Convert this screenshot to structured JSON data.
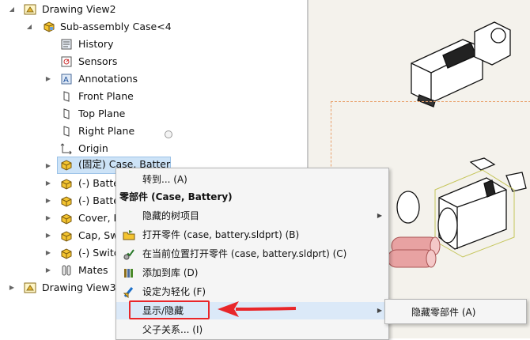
{
  "tree": {
    "items": [
      {
        "label": "Drawing View2",
        "icon": "drawing-view-icon"
      },
      {
        "label": "Sub-assembly Case<4",
        "icon": "assembly-icon"
      },
      {
        "label": "History",
        "icon": "history-icon"
      },
      {
        "label": "Sensors",
        "icon": "sensors-icon"
      },
      {
        "label": "Annotations",
        "icon": "annotations-icon"
      },
      {
        "label": "Front Plane",
        "icon": "plane-icon"
      },
      {
        "label": "Top Plane",
        "icon": "plane-icon"
      },
      {
        "label": "Right Plane",
        "icon": "plane-icon"
      },
      {
        "label": "Origin",
        "icon": "origin-icon"
      },
      {
        "label": "(固定) Case, Batter",
        "icon": "part-icon"
      },
      {
        "label": "(-) Batte",
        "icon": "part-icon"
      },
      {
        "label": "(-) Batte",
        "icon": "part-icon"
      },
      {
        "label": "Cover, B",
        "icon": "part-icon"
      },
      {
        "label": "Cap, Sw",
        "icon": "part-icon"
      },
      {
        "label": "(-) Switc",
        "icon": "part-icon"
      },
      {
        "label": "Mates",
        "icon": "mates-icon"
      },
      {
        "label": "Drawing View3",
        "icon": "drawing-view-icon"
      }
    ]
  },
  "context_menu": {
    "items": [
      {
        "label": "转到... (A)"
      },
      {
        "label": "零部件 (Case, Battery)"
      },
      {
        "label": "隐藏的树项目"
      },
      {
        "label": "打开零件 (case, battery.sldprt) (B)",
        "icon": "open-part-icon"
      },
      {
        "label": "在当前位置打开零件 (case, battery.sldprt) (C)",
        "icon": "open-in-place-icon"
      },
      {
        "label": "添加到库 (D)",
        "icon": "add-to-library-icon"
      },
      {
        "label": "设定为轻化 (F)",
        "icon": "lightweight-icon"
      },
      {
        "label": "显示/隐藏"
      },
      {
        "label": "父子关系... (I)"
      }
    ]
  },
  "submenu": {
    "items": [
      {
        "label": "隐藏零部件 (A)"
      }
    ]
  },
  "colors": {
    "highlight": "#e8262a",
    "selection": "#cde3f7"
  }
}
